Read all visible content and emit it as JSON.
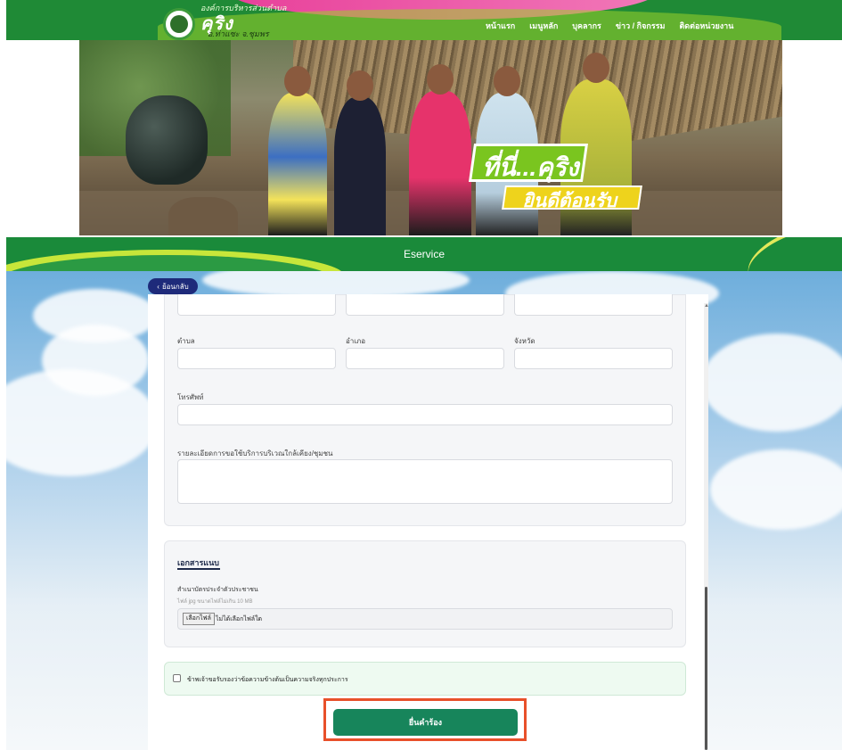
{
  "header": {
    "org_line": "องค์การบริหารส่วนตำบล",
    "brand": "คุริง",
    "brand_sub": "อ.ท่าแซะ จ.ชุมพร",
    "nav": [
      "หน้าแรก",
      "เมนูหลัก",
      "บุคลากร",
      "ข่าว / กิจกรรม",
      "ติดต่อหน่วยงาน"
    ]
  },
  "hero": {
    "welcome_main": "ที่นี่...คุริง",
    "welcome_sub": "ยินดีต้อนรับ"
  },
  "eservice": {
    "title": "Eservice"
  },
  "back_button": {
    "label": "ย้อนกลับ"
  },
  "address": {
    "subdistrict_label": "ตำบล",
    "district_label": "อำเภอ",
    "province_label": "จังหวัด"
  },
  "phone": {
    "label": "โทรศัพท์"
  },
  "details": {
    "label": "รายละเอียดการขอใช้บริการบริเวณใกล้เคียง/ชุมชน"
  },
  "attachments": {
    "title": "เอกสารแนบ",
    "file_label": "สำเนาบัตรประจำตัวประชาชน",
    "file_hint": "ไฟล์ jpg ขนาดไฟล์ไม่เกิน 10 MB",
    "choose_button": "เลือกไฟล์",
    "no_file": "ไม่ได้เลือกไฟล์ใด"
  },
  "confirm": {
    "label": "ข้าพเจ้าขอรับรองว่าข้อความข้างต้นเป็นความจริงทุกประการ"
  },
  "submit": {
    "label": "ยื่นคำร้อง"
  },
  "colors": {
    "header_green": "#1f8a36",
    "submit_green": "#17855b",
    "highlight": "#e8502a",
    "back_button": "#1e2a7a"
  }
}
